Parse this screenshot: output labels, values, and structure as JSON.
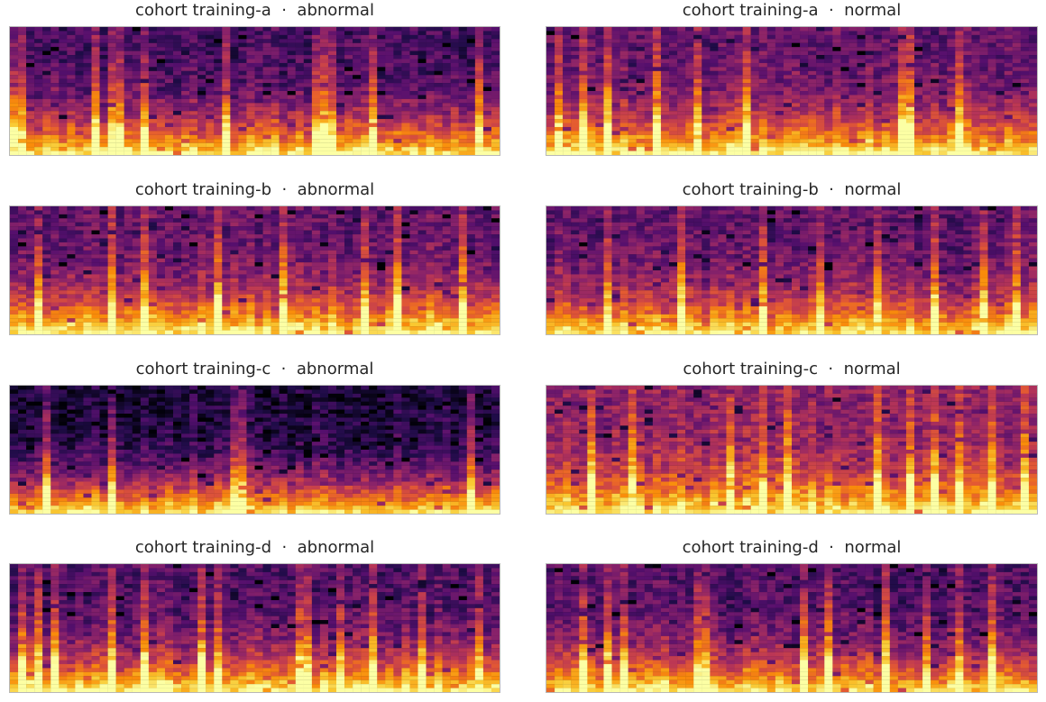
{
  "chart_data": [
    {
      "type": "heatmap",
      "title": "cohort training-a  ·  abnormal",
      "cohort": "training-a",
      "label": "abnormal",
      "colormap": "inferno",
      "grid": false,
      "xticks": [],
      "yticks": [],
      "columns": 60,
      "rows": 32,
      "seed": 11,
      "base": 0.22,
      "bottom_boost": 0.75,
      "bright_columns": [
        0,
        1,
        10,
        12,
        13,
        16,
        26,
        37,
        38,
        39,
        44,
        57
      ]
    },
    {
      "type": "heatmap",
      "title": "cohort training-a  ·  normal",
      "cohort": "training-a",
      "label": "normal",
      "colormap": "inferno",
      "grid": false,
      "xticks": [],
      "yticks": [],
      "columns": 60,
      "rows": 32,
      "seed": 23,
      "base": 0.3,
      "bottom_boost": 0.7,
      "bright_columns": [
        1,
        4,
        7,
        13,
        18,
        24,
        43,
        44,
        50
      ]
    },
    {
      "type": "heatmap",
      "title": "cohort training-b  ·  abnormal",
      "cohort": "training-b",
      "label": "abnormal",
      "colormap": "inferno",
      "grid": false,
      "xticks": [],
      "yticks": [],
      "columns": 60,
      "rows": 32,
      "seed": 37,
      "base": 0.3,
      "bottom_boost": 0.7,
      "bright_columns": [
        3,
        12,
        16,
        25,
        33,
        43,
        47,
        55
      ]
    },
    {
      "type": "heatmap",
      "title": "cohort training-b  ·  normal",
      "cohort": "training-b",
      "label": "normal",
      "colormap": "inferno",
      "grid": false,
      "xticks": [],
      "yticks": [],
      "columns": 60,
      "rows": 32,
      "seed": 41,
      "base": 0.28,
      "bottom_boost": 0.65,
      "bright_columns": [
        7,
        16,
        26,
        33,
        40,
        47,
        53,
        57
      ]
    },
    {
      "type": "heatmap",
      "title": "cohort training-c  ·  abnormal",
      "cohort": "training-c",
      "label": "abnormal",
      "colormap": "inferno",
      "grid": false,
      "xticks": [],
      "yticks": [],
      "columns": 60,
      "rows": 32,
      "seed": 53,
      "base": 0.12,
      "bottom_boost": 0.85,
      "bright_columns": [
        4,
        12,
        27,
        28,
        56
      ]
    },
    {
      "type": "heatmap",
      "title": "cohort training-c  ·  normal",
      "cohort": "training-c",
      "label": "normal",
      "colormap": "inferno",
      "grid": false,
      "xticks": [],
      "yticks": [],
      "columns": 60,
      "rows": 32,
      "seed": 67,
      "base": 0.4,
      "bottom_boost": 0.6,
      "bright_columns": [
        5,
        10,
        22,
        26,
        29,
        40,
        44,
        47,
        50,
        54,
        58
      ]
    },
    {
      "type": "heatmap",
      "title": "cohort training-d  ·  abnormal",
      "cohort": "training-d",
      "label": "abnormal",
      "colormap": "inferno",
      "grid": false,
      "xticks": [],
      "yticks": [],
      "columns": 60,
      "rows": 32,
      "seed": 79,
      "base": 0.25,
      "bottom_boost": 0.75,
      "bright_columns": [
        1,
        3,
        5,
        12,
        16,
        23,
        25,
        35,
        36,
        40,
        44,
        50,
        57
      ]
    },
    {
      "type": "heatmap",
      "title": "cohort training-d  ·  normal",
      "cohort": "training-d",
      "label": "normal",
      "colormap": "inferno",
      "grid": false,
      "xticks": [],
      "yticks": [],
      "columns": 60,
      "rows": 32,
      "seed": 83,
      "base": 0.25,
      "bottom_boost": 0.7,
      "bright_columns": [
        4,
        7,
        9,
        18,
        19,
        31,
        34,
        41,
        46,
        50,
        54
      ]
    }
  ]
}
